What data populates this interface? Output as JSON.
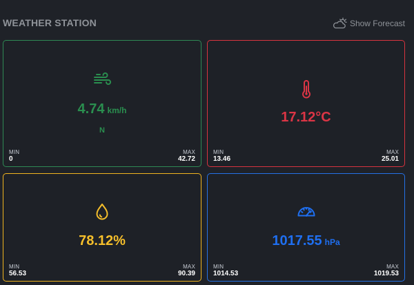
{
  "header": {
    "title": "WEATHER STATION",
    "forecast_label": "Show Forecast",
    "forecast_icon": "cloud-sun-icon"
  },
  "tiles": [
    {
      "id": "wind",
      "icon": "wind-icon",
      "value": "4.74",
      "unit": "km/h",
      "direction": "N",
      "min_label": "MIN",
      "min_value": "0",
      "max_label": "MAX",
      "max_value": "42.72",
      "color": "#2a8f4f"
    },
    {
      "id": "temperature",
      "icon": "thermometer-icon",
      "value": "17.12°C",
      "min_label": "MIN",
      "min_value": "13.46",
      "max_label": "MAX",
      "max_value": "25.01",
      "color": "#dc3545"
    },
    {
      "id": "humidity",
      "icon": "droplet-icon",
      "value": "78.12%",
      "min_label": "MIN",
      "min_value": "56.53",
      "max_label": "MAX",
      "max_value": "90.39",
      "color": "#f6bf2b"
    },
    {
      "id": "pressure",
      "icon": "gauge-icon",
      "value": "1017.55",
      "unit": "hPa",
      "min_label": "MIN",
      "min_value": "1014.53",
      "max_label": "MAX",
      "max_value": "1019.53",
      "color": "#1f6ff0"
    }
  ]
}
